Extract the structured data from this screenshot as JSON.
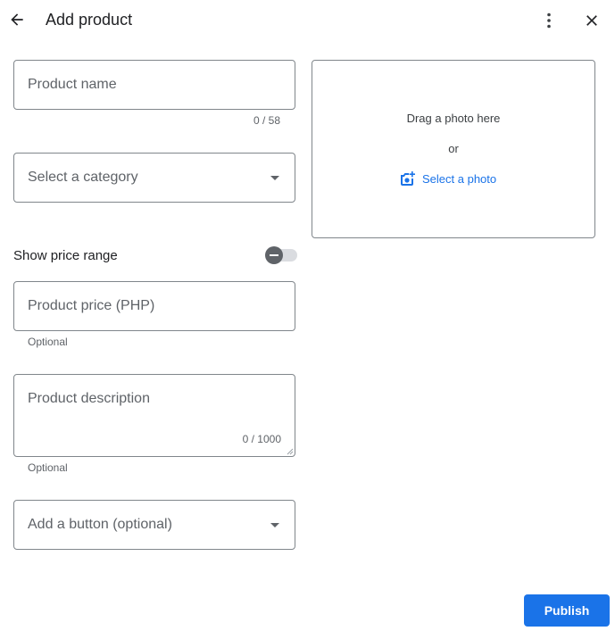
{
  "header": {
    "title": "Add product",
    "back_icon": "arrow-back-icon",
    "more_icon": "more-vert-icon",
    "close_icon": "close-icon"
  },
  "form": {
    "product_name": {
      "placeholder": "Product name",
      "value": "",
      "counter": "0 / 58"
    },
    "category": {
      "placeholder": "Select a category",
      "selected": ""
    },
    "price_range": {
      "label": "Show price range",
      "enabled": false
    },
    "price": {
      "placeholder": "Product price (PHP)",
      "value": "",
      "helper": "Optional"
    },
    "description": {
      "placeholder": "Product description",
      "value": "",
      "counter": "0 / 1000",
      "helper": "Optional"
    },
    "button": {
      "placeholder": "Add a button (optional)",
      "selected": ""
    }
  },
  "photo": {
    "drag_text": "Drag a photo here",
    "or_text": "or",
    "select_label": "Select a photo",
    "select_icon": "add-photo-icon"
  },
  "footer": {
    "publish_label": "Publish"
  },
  "colors": {
    "accent": "#1a73e8",
    "border": "#80868b",
    "text": "#202124",
    "secondary": "#5f6368"
  }
}
